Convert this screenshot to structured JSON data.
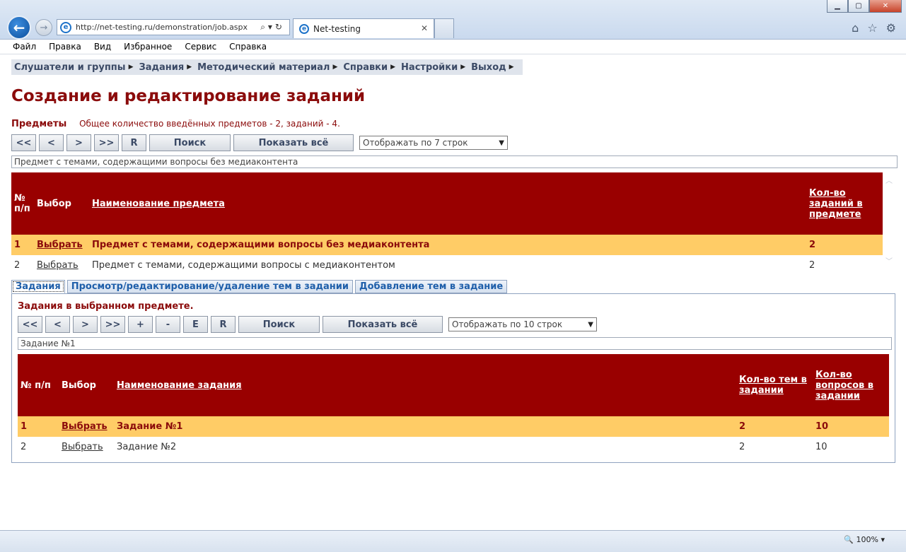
{
  "browser": {
    "url": "http://net-testing.ru/demonstration/job.aspx",
    "tab_title": "Net-testing",
    "zoom": "100%"
  },
  "menu": [
    "Файл",
    "Правка",
    "Вид",
    "Избранное",
    "Сервис",
    "Справка"
  ],
  "nav": [
    "Слушатели и группы",
    "Задания",
    "Методический материал",
    "Справки",
    "Настройки",
    "Выход"
  ],
  "page_title": "Создание и редактирование заданий",
  "subjects": {
    "label": "Предметы",
    "info": "Общее количество введённых предметов - 2, заданий - 4.",
    "buttons": {
      "first": "<<",
      "prev": "<",
      "next": ">",
      "last": ">>",
      "reset": "R",
      "search": "Поиск",
      "show_all": "Показать всё"
    },
    "rows_select": "Отображать по 7 строк",
    "filter_value": "Предмет с темами, содержащими вопросы без медиаконтента",
    "headers": {
      "num": "№ п/п",
      "choose": "Выбор",
      "name": "Наименование предмета",
      "count": "Кол-во заданий в предмете"
    },
    "rows": [
      {
        "num": "1",
        "choose": "Выбрать",
        "name": "Предмет с темами, содержащими вопросы без медиаконтента",
        "count": "2"
      },
      {
        "num": "2",
        "choose": "Выбрать",
        "name": "Предмет с темами, содержащими вопросы с медиаконтентом",
        "count": "2"
      }
    ]
  },
  "tabs": [
    "Задания",
    "Просмотр/редактирование/удаление тем в задании",
    "Добавление тем в задание"
  ],
  "tasks": {
    "title": "Задания в выбранном предмете.",
    "buttons": {
      "first": "<<",
      "prev": "<",
      "next": ">",
      "last": ">>",
      "add": "+",
      "remove": "-",
      "edit": "E",
      "reset": "R",
      "search": "Поиск",
      "show_all": "Показать всё"
    },
    "rows_select": "Отображать по 10 строк",
    "filter_value": "Задание №1",
    "headers": {
      "num": "№ п/п",
      "choose": "Выбор",
      "name": "Наименование задания",
      "themes": "Кол-во тем в задании",
      "questions": "Кол-во вопросов в задании"
    },
    "rows": [
      {
        "num": "1",
        "choose": "Выбрать",
        "name": "Задание №1",
        "themes": "2",
        "questions": "10"
      },
      {
        "num": "2",
        "choose": "Выбрать",
        "name": "Задание №2",
        "themes": "2",
        "questions": "10"
      }
    ]
  },
  "colors": {
    "header": "#990000",
    "selected_row": "#ffcc66",
    "title": "#8b0b0b"
  }
}
